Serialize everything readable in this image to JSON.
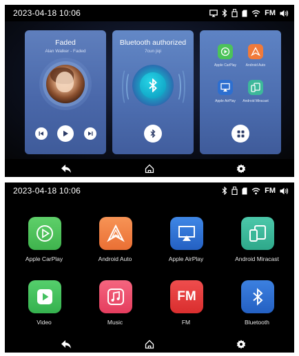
{
  "screen1": {
    "status": {
      "datetime": "2023-04-18 10:06",
      "fm_label": "FM",
      "icons": [
        "screen-mirror-icon",
        "bluetooth-icon",
        "usb-icon",
        "sd-card-icon",
        "wifi-icon",
        "fm-icon",
        "volume-icon"
      ]
    },
    "media_card": {
      "title": "Faded",
      "subtitle": "Alan Walker - Faded",
      "icons": [
        "previous-icon",
        "play-icon",
        "next-icon"
      ]
    },
    "bluetooth_card": {
      "title": "Bluetooth authorized",
      "device": "7cun jiqi"
    },
    "connect_card": {
      "apps": [
        {
          "label": "Apple CarPlay",
          "icon": "carplay-icon",
          "color": "#4cc35a"
        },
        {
          "label": "Android Auto",
          "icon": "android-auto-icon",
          "color": "#f07a3a"
        },
        {
          "label": "Apple AirPlay",
          "icon": "airplay-icon",
          "color": "#2d6fd0"
        },
        {
          "label": "Android Miracast",
          "icon": "miracast-icon",
          "color": "#3db89a"
        }
      ]
    },
    "nav": [
      "back-icon",
      "home-icon",
      "settings-icon"
    ]
  },
  "screen2": {
    "status": {
      "datetime": "2023-04-18 10:06",
      "fm_label": "FM",
      "icons": [
        "bluetooth-icon",
        "usb-icon",
        "sd-card-icon",
        "wifi-icon",
        "fm-icon",
        "volume-icon"
      ]
    },
    "apps": [
      {
        "label": "Apple CarPlay",
        "icon": "carplay-icon",
        "color": "#4cc35a"
      },
      {
        "label": "Android Auto",
        "icon": "android-auto-icon",
        "color": "#f08244"
      },
      {
        "label": "Apple AirPlay",
        "icon": "airplay-icon",
        "color": "#2f73d6"
      },
      {
        "label": "Android Miracast",
        "icon": "miracast-icon",
        "color": "#39b99b"
      },
      {
        "label": "Video",
        "icon": "video-icon",
        "color": "#43c160"
      },
      {
        "label": "Music",
        "icon": "music-icon",
        "color": "#ee4f6e"
      },
      {
        "label": "FM",
        "icon": "fm-radio-icon",
        "color": "#e53a3a",
        "glyph": "FM"
      },
      {
        "label": "Bluetooth",
        "icon": "bluetooth-app-icon",
        "color": "#2f6fd0"
      }
    ],
    "nav": [
      "back-icon",
      "home-icon",
      "settings-icon"
    ]
  }
}
